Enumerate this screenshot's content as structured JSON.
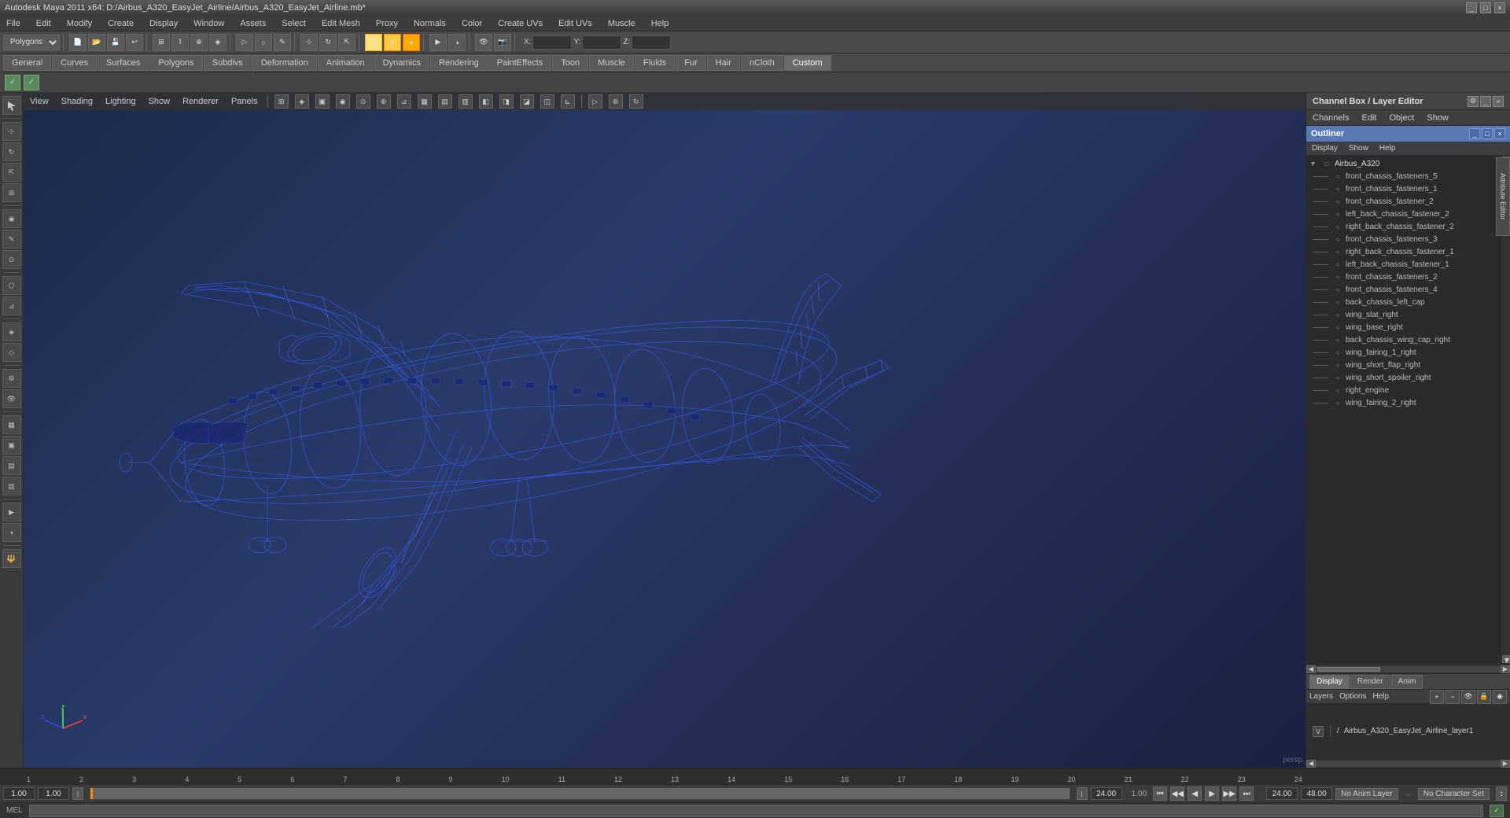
{
  "titlebar": {
    "title": "Autodesk Maya 2011 x64: D:/Airbus_A320_EasyJet_Airline/Airbus_A320_EasyJet_Airline.mb*",
    "controls": [
      "_",
      "□",
      "×"
    ]
  },
  "menubar": {
    "items": [
      "File",
      "Edit",
      "Modify",
      "Create",
      "Display",
      "Window",
      "Assets",
      "Select",
      "Edit Mesh",
      "Proxy",
      "Normals",
      "Color",
      "Create UVs",
      "Edit UVs",
      "Muscle",
      "Help"
    ]
  },
  "mode_dropdown": "Polygons",
  "tabs": {
    "items": [
      "General",
      "Curves",
      "Surfaces",
      "Polygons",
      "Subdivs",
      "Deformation",
      "Animation",
      "Dynamics",
      "Rendering",
      "PaintEffects",
      "Toon",
      "Muscle",
      "Fluids",
      "Fur",
      "Hair",
      "nCloth",
      "Custom"
    ],
    "active": "Custom"
  },
  "viewport": {
    "menus": [
      "View",
      "Shading",
      "Lighting",
      "Show",
      "Renderer",
      "Panels"
    ],
    "label": "persp"
  },
  "channel_box": {
    "title": "Channel Box / Layer Editor",
    "menus": [
      "Channels",
      "Edit",
      "Object",
      "Show"
    ]
  },
  "outliner": {
    "title": "Outliner",
    "menus": [
      "Display",
      "Show",
      "Help"
    ],
    "items": [
      {
        "label": "Airbus_A320",
        "type": "root",
        "expanded": true
      },
      {
        "label": "front_chassis_fasteners_5",
        "type": "mesh",
        "depth": 1
      },
      {
        "label": "front_chassis_fasteners_1",
        "type": "mesh",
        "depth": 1
      },
      {
        "label": "front_chassis_fastener_2",
        "type": "mesh",
        "depth": 1
      },
      {
        "label": "left_back_chassis_fastener_2",
        "type": "mesh",
        "depth": 1
      },
      {
        "label": "right_back_chassis_fastener_2",
        "type": "mesh",
        "depth": 1
      },
      {
        "label": "front_chassis_fasteners_3",
        "type": "mesh",
        "depth": 1
      },
      {
        "label": "right_back_chassis_fastener_1",
        "type": "mesh",
        "depth": 1
      },
      {
        "label": "left_back_chassis_fastener_1",
        "type": "mesh",
        "depth": 1
      },
      {
        "label": "front_chassis_fasteners_2",
        "type": "mesh",
        "depth": 1
      },
      {
        "label": "front_chassis_fasteners_4",
        "type": "mesh",
        "depth": 1
      },
      {
        "label": "back_chassis_left_cap",
        "type": "mesh",
        "depth": 1
      },
      {
        "label": "wing_slat_right",
        "type": "mesh",
        "depth": 1
      },
      {
        "label": "wing_base_right",
        "type": "mesh",
        "depth": 1
      },
      {
        "label": "back_chassis_wing_cap_right",
        "type": "mesh",
        "depth": 1
      },
      {
        "label": "wing_fairing_1_right",
        "type": "mesh",
        "depth": 1
      },
      {
        "label": "wing_short_flap_right",
        "type": "mesh",
        "depth": 1
      },
      {
        "label": "wing_short_spoiler_right",
        "type": "mesh",
        "depth": 1
      },
      {
        "label": "right_engine",
        "type": "mesh",
        "depth": 1
      },
      {
        "label": "wing_fairing_2_right",
        "type": "mesh",
        "depth": 1
      }
    ]
  },
  "layers": {
    "tabs": [
      "Display",
      "Render",
      "Anim"
    ],
    "active_tab": "Display",
    "menus": [
      "Layers",
      "Options",
      "Help"
    ],
    "items": [
      {
        "label": "Airbus_A320_EasyJet_Airline_layer1",
        "visible": true,
        "prefix": "V"
      }
    ]
  },
  "timeline": {
    "start": "1.00",
    "end": "24.00",
    "current": "1.00",
    "range_end": "24.00",
    "fps_end": "48.00",
    "ticks": [
      "1",
      "2",
      "3",
      "4",
      "5",
      "6",
      "7",
      "8",
      "9",
      "10",
      "11",
      "12",
      "13",
      "14",
      "15",
      "16",
      "17",
      "18",
      "19",
      "20",
      "21",
      "22",
      "23",
      "24"
    ],
    "anim_layer": "No Anim Layer",
    "char_set": "No Character Set"
  },
  "playback": {
    "controls": [
      "⏮",
      "◀◀",
      "◀",
      "▶",
      "▶▶",
      "⏭"
    ],
    "current_frame": "1.00"
  },
  "statusbar": {
    "mel_label": "MEL",
    "command_input": ""
  }
}
